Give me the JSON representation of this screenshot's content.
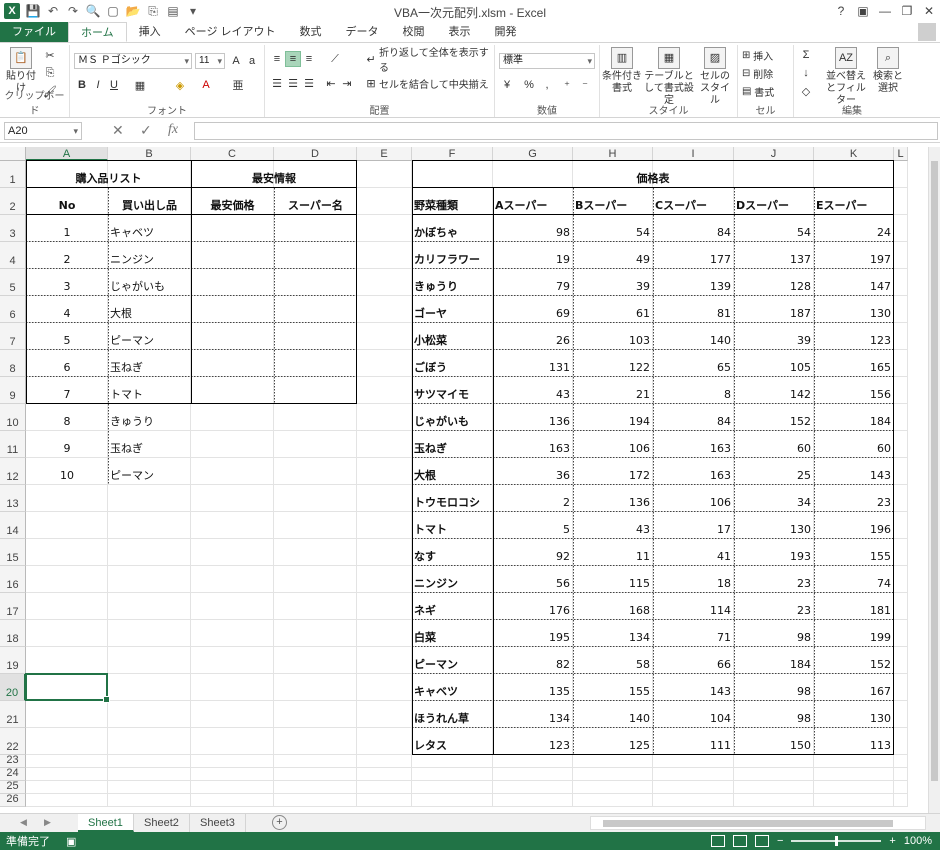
{
  "window": {
    "title": "VBA一次元配列.xlsm - Excel",
    "help": "?",
    "minimize": "—",
    "restore": "❐",
    "close": "✕"
  },
  "ribbon_tabs": [
    "ファイル",
    "ホーム",
    "挿入",
    "ページ レイアウト",
    "数式",
    "データ",
    "校閲",
    "表示",
    "開発"
  ],
  "ribbon": {
    "paste": "貼り付け",
    "clipboard_group": "クリップボード",
    "font_name": "ＭＳ Ｐゴシック",
    "font_size": "11",
    "font_group": "フォント",
    "wrap_text": "折り返して全体を表示する",
    "merge_center": "セルを結合して中央揃え",
    "alignment_group": "配置",
    "number_format": "標準",
    "number_group": "数値",
    "conditional_format": "条件付き書式",
    "format_as_table": "テーブルとして書式設定",
    "cell_styles": "セルのスタイル",
    "styles_group": "スタイル",
    "insert": "挿入",
    "delete": "削除",
    "format": "書式",
    "cells_group": "セル",
    "sort_filter": "並べ替えとフィルター",
    "find_select": "検索と選択",
    "editing_group": "編集"
  },
  "formula_bar": {
    "name_box": "A20",
    "fx": "fx",
    "cancel": "✕",
    "enter": "✓",
    "formula": ""
  },
  "columns": [
    "A",
    "B",
    "C",
    "D",
    "E",
    "F",
    "G",
    "H",
    "I",
    "J",
    "K",
    "L"
  ],
  "rows": [
    "1",
    "2",
    "3",
    "4",
    "5",
    "6",
    "7",
    "8",
    "9",
    "10",
    "11",
    "12",
    "13",
    "14",
    "15",
    "16",
    "17",
    "18",
    "19",
    "20",
    "21",
    "22",
    "23",
    "24",
    "25",
    "26"
  ],
  "purchase_list": {
    "title": "購入品リスト",
    "header_no": "No",
    "header_item": "買い出し品",
    "items": [
      {
        "no": "1",
        "name": "キャベツ"
      },
      {
        "no": "2",
        "name": "ニンジン"
      },
      {
        "no": "3",
        "name": "じゃがいも"
      },
      {
        "no": "4",
        "name": "大根"
      },
      {
        "no": "5",
        "name": "ピーマン"
      },
      {
        "no": "6",
        "name": "玉ねぎ"
      },
      {
        "no": "7",
        "name": "トマト"
      },
      {
        "no": "8",
        "name": "きゅうり"
      },
      {
        "no": "9",
        "name": "玉ねぎ"
      },
      {
        "no": "10",
        "name": "ピーマン"
      }
    ]
  },
  "cheapest_info": {
    "title": "最安情報",
    "header_price": "最安価格",
    "header_store": "スーパー名"
  },
  "price_table": {
    "title": "価格表",
    "header_kind": "野菜種類",
    "stores": [
      "Aスーパー",
      "Bスーパー",
      "Cスーパー",
      "Dスーパー",
      "Eスーパー"
    ],
    "rows": [
      {
        "name": "かぼちゃ",
        "prices": [
          "98",
          "54",
          "84",
          "54",
          "24"
        ]
      },
      {
        "name": "カリフラワー",
        "prices": [
          "19",
          "49",
          "177",
          "137",
          "197"
        ]
      },
      {
        "name": "きゅうり",
        "prices": [
          "79",
          "39",
          "139",
          "128",
          "147"
        ]
      },
      {
        "name": "ゴーヤ",
        "prices": [
          "69",
          "61",
          "81",
          "187",
          "130"
        ]
      },
      {
        "name": "小松菜",
        "prices": [
          "26",
          "103",
          "140",
          "39",
          "123"
        ]
      },
      {
        "name": "ごぼう",
        "prices": [
          "131",
          "122",
          "65",
          "105",
          "165"
        ]
      },
      {
        "name": "サツマイモ",
        "prices": [
          "43",
          "21",
          "8",
          "142",
          "156"
        ]
      },
      {
        "name": "じゃがいも",
        "prices": [
          "136",
          "194",
          "84",
          "152",
          "184"
        ]
      },
      {
        "name": "玉ねぎ",
        "prices": [
          "163",
          "106",
          "163",
          "60",
          "60"
        ]
      },
      {
        "name": "大根",
        "prices": [
          "36",
          "172",
          "163",
          "25",
          "143"
        ]
      },
      {
        "name": "トウモロコシ",
        "prices": [
          "2",
          "136",
          "106",
          "34",
          "23"
        ]
      },
      {
        "name": "トマト",
        "prices": [
          "5",
          "43",
          "17",
          "130",
          "196"
        ]
      },
      {
        "name": "なす",
        "prices": [
          "92",
          "11",
          "41",
          "193",
          "155"
        ]
      },
      {
        "name": "ニンジン",
        "prices": [
          "56",
          "115",
          "18",
          "23",
          "74"
        ]
      },
      {
        "name": "ネギ",
        "prices": [
          "176",
          "168",
          "114",
          "23",
          "181"
        ]
      },
      {
        "name": "白菜",
        "prices": [
          "195",
          "134",
          "71",
          "98",
          "199"
        ]
      },
      {
        "name": "ピーマン",
        "prices": [
          "82",
          "58",
          "66",
          "184",
          "152"
        ]
      },
      {
        "name": "キャベツ",
        "prices": [
          "135",
          "155",
          "143",
          "98",
          "167"
        ]
      },
      {
        "name": "ほうれん草",
        "prices": [
          "134",
          "140",
          "104",
          "98",
          "130"
        ]
      },
      {
        "name": "レタス",
        "prices": [
          "123",
          "125",
          "111",
          "150",
          "113"
        ]
      }
    ]
  },
  "sheets": [
    "Sheet1",
    "Sheet2",
    "Sheet3"
  ],
  "add_sheet": "+",
  "status": {
    "ready": "準備完了",
    "zoom": "100%"
  },
  "colors": {
    "accent": "#217346"
  }
}
